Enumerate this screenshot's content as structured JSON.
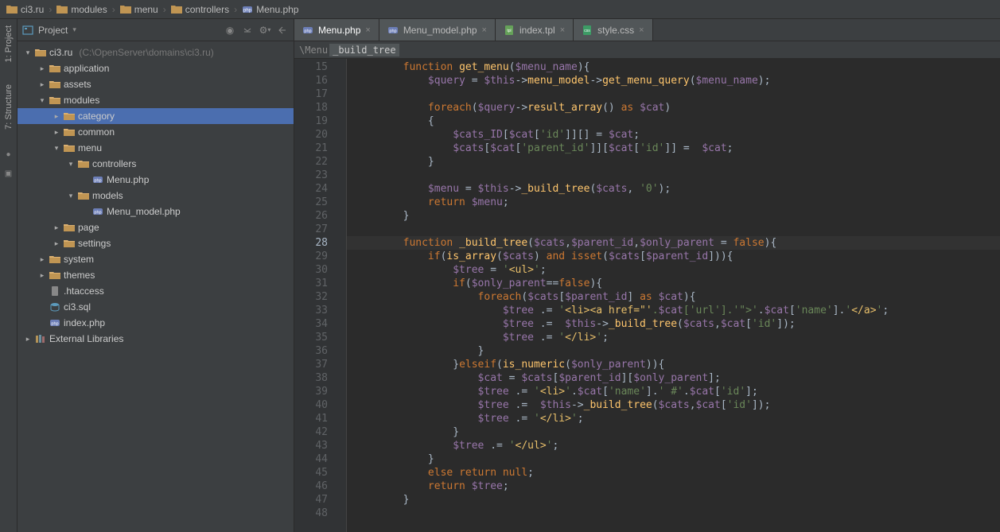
{
  "breadcrumbs": [
    "ci3.ru",
    "modules",
    "menu",
    "controllers",
    "Menu.php"
  ],
  "sidebar": {
    "title": "Project",
    "actions": [
      "target",
      "collapse",
      "gear",
      "hide"
    ]
  },
  "sideTools": {
    "project": "1: Project",
    "structure": "7: Structure"
  },
  "tree": [
    {
      "indent": 0,
      "arrow": "down",
      "icon": "folder",
      "name": "ci3.ru",
      "path": "(C:\\OpenServer\\domains\\ci3.ru)"
    },
    {
      "indent": 1,
      "arrow": "right",
      "icon": "folder",
      "name": "application"
    },
    {
      "indent": 1,
      "arrow": "right",
      "icon": "folder",
      "name": "assets"
    },
    {
      "indent": 1,
      "arrow": "down",
      "icon": "folder",
      "name": "modules"
    },
    {
      "indent": 2,
      "arrow": "right",
      "icon": "folder",
      "name": "category",
      "selected": true
    },
    {
      "indent": 2,
      "arrow": "right",
      "icon": "folder",
      "name": "common"
    },
    {
      "indent": 2,
      "arrow": "down",
      "icon": "folder",
      "name": "menu"
    },
    {
      "indent": 3,
      "arrow": "down",
      "icon": "folder",
      "name": "controllers"
    },
    {
      "indent": 4,
      "arrow": "",
      "icon": "php",
      "name": "Menu.php"
    },
    {
      "indent": 3,
      "arrow": "down",
      "icon": "folder",
      "name": "models"
    },
    {
      "indent": 4,
      "arrow": "",
      "icon": "php",
      "name": "Menu_model.php"
    },
    {
      "indent": 2,
      "arrow": "right",
      "icon": "folder",
      "name": "page"
    },
    {
      "indent": 2,
      "arrow": "right",
      "icon": "folder",
      "name": "settings"
    },
    {
      "indent": 1,
      "arrow": "right",
      "icon": "folder",
      "name": "system"
    },
    {
      "indent": 1,
      "arrow": "right",
      "icon": "folder",
      "name": "themes"
    },
    {
      "indent": 1,
      "arrow": "",
      "icon": "file",
      "name": ".htaccess"
    },
    {
      "indent": 1,
      "arrow": "",
      "icon": "sql",
      "name": "ci3.sql"
    },
    {
      "indent": 1,
      "arrow": "",
      "icon": "php",
      "name": "index.php"
    },
    {
      "indent": 0,
      "arrow": "right",
      "icon": "lib",
      "name": "External Libraries"
    }
  ],
  "tabs": [
    {
      "icon": "php",
      "label": "Menu.php",
      "active": true
    },
    {
      "icon": "php",
      "label": "Menu_model.php"
    },
    {
      "icon": "tpl",
      "label": "index.tpl"
    },
    {
      "icon": "css",
      "label": "style.css"
    }
  ],
  "editorBreadcrumb": {
    "class": "\\Menu",
    "method": "_build_tree"
  },
  "code": {
    "startLine": 15,
    "highlightLine": 28,
    "lines": [
      "        function get_menu($menu_name){",
      "            $query = $this->menu_model->get_menu_query($menu_name);",
      "",
      "            foreach($query->result_array() as $cat)",
      "            {",
      "                $cats_ID[$cat['id']][] = $cat;",
      "                $cats[$cat['parent_id']][$cat['id']] =  $cat;",
      "            }",
      "",
      "            $menu = $this->_build_tree($cats, '0');",
      "            return $menu;",
      "        }",
      "",
      "        function _build_tree($cats,$parent_id,$only_parent = false){",
      "            if(is_array($cats) and isset($cats[$parent_id])){",
      "                $tree = '<ul>';",
      "                if($only_parent==false){",
      "                    foreach($cats[$parent_id] as $cat){",
      "                        $tree .= '<li><a href=\"'.$cat['url'].'\">'.$cat['name'].'</a>';",
      "                        $tree .=  $this->_build_tree($cats,$cat['id']);",
      "                        $tree .= '</li>';",
      "                    }",
      "                }elseif(is_numeric($only_parent)){",
      "                    $cat = $cats[$parent_id][$only_parent];",
      "                    $tree .= '<li>'.$cat['name'].' #'.$cat['id'];",
      "                    $tree .=  $this->_build_tree($cats,$cat['id']);",
      "                    $tree .= '</li>';",
      "                }",
      "                $tree .= '</ul>';",
      "            }",
      "            else return null;",
      "            return $tree;",
      "        }",
      ""
    ]
  }
}
